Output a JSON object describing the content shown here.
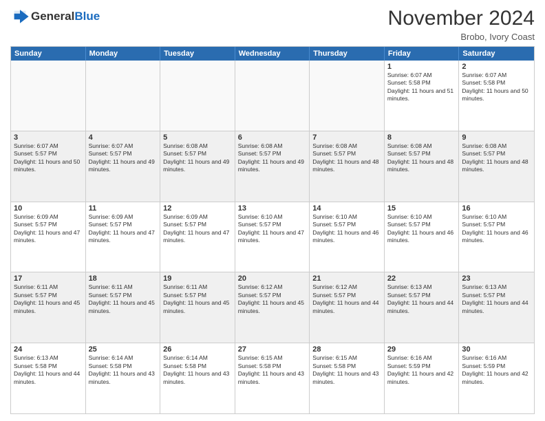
{
  "header": {
    "logo_general": "General",
    "logo_blue": "Blue",
    "month": "November 2024",
    "location": "Brobo, Ivory Coast"
  },
  "calendar": {
    "days_of_week": [
      "Sunday",
      "Monday",
      "Tuesday",
      "Wednesday",
      "Thursday",
      "Friday",
      "Saturday"
    ],
    "weeks": [
      [
        {
          "day": "",
          "empty": true
        },
        {
          "day": "",
          "empty": true
        },
        {
          "day": "",
          "empty": true
        },
        {
          "day": "",
          "empty": true
        },
        {
          "day": "",
          "empty": true
        },
        {
          "day": "1",
          "sunrise": "6:07 AM",
          "sunset": "5:58 PM",
          "daylight": "11 hours and 51 minutes."
        },
        {
          "day": "2",
          "sunrise": "6:07 AM",
          "sunset": "5:58 PM",
          "daylight": "11 hours and 50 minutes."
        }
      ],
      [
        {
          "day": "3",
          "sunrise": "6:07 AM",
          "sunset": "5:57 PM",
          "daylight": "11 hours and 50 minutes."
        },
        {
          "day": "4",
          "sunrise": "6:07 AM",
          "sunset": "5:57 PM",
          "daylight": "11 hours and 49 minutes."
        },
        {
          "day": "5",
          "sunrise": "6:08 AM",
          "sunset": "5:57 PM",
          "daylight": "11 hours and 49 minutes."
        },
        {
          "day": "6",
          "sunrise": "6:08 AM",
          "sunset": "5:57 PM",
          "daylight": "11 hours and 49 minutes."
        },
        {
          "day": "7",
          "sunrise": "6:08 AM",
          "sunset": "5:57 PM",
          "daylight": "11 hours and 48 minutes."
        },
        {
          "day": "8",
          "sunrise": "6:08 AM",
          "sunset": "5:57 PM",
          "daylight": "11 hours and 48 minutes."
        },
        {
          "day": "9",
          "sunrise": "6:08 AM",
          "sunset": "5:57 PM",
          "daylight": "11 hours and 48 minutes."
        }
      ],
      [
        {
          "day": "10",
          "sunrise": "6:09 AM",
          "sunset": "5:57 PM",
          "daylight": "11 hours and 47 minutes."
        },
        {
          "day": "11",
          "sunrise": "6:09 AM",
          "sunset": "5:57 PM",
          "daylight": "11 hours and 47 minutes."
        },
        {
          "day": "12",
          "sunrise": "6:09 AM",
          "sunset": "5:57 PM",
          "daylight": "11 hours and 47 minutes."
        },
        {
          "day": "13",
          "sunrise": "6:10 AM",
          "sunset": "5:57 PM",
          "daylight": "11 hours and 47 minutes."
        },
        {
          "day": "14",
          "sunrise": "6:10 AM",
          "sunset": "5:57 PM",
          "daylight": "11 hours and 46 minutes."
        },
        {
          "day": "15",
          "sunrise": "6:10 AM",
          "sunset": "5:57 PM",
          "daylight": "11 hours and 46 minutes."
        },
        {
          "day": "16",
          "sunrise": "6:10 AM",
          "sunset": "5:57 PM",
          "daylight": "11 hours and 46 minutes."
        }
      ],
      [
        {
          "day": "17",
          "sunrise": "6:11 AM",
          "sunset": "5:57 PM",
          "daylight": "11 hours and 45 minutes."
        },
        {
          "day": "18",
          "sunrise": "6:11 AM",
          "sunset": "5:57 PM",
          "daylight": "11 hours and 45 minutes."
        },
        {
          "day": "19",
          "sunrise": "6:11 AM",
          "sunset": "5:57 PM",
          "daylight": "11 hours and 45 minutes."
        },
        {
          "day": "20",
          "sunrise": "6:12 AM",
          "sunset": "5:57 PM",
          "daylight": "11 hours and 45 minutes."
        },
        {
          "day": "21",
          "sunrise": "6:12 AM",
          "sunset": "5:57 PM",
          "daylight": "11 hours and 44 minutes."
        },
        {
          "day": "22",
          "sunrise": "6:13 AM",
          "sunset": "5:57 PM",
          "daylight": "11 hours and 44 minutes."
        },
        {
          "day": "23",
          "sunrise": "6:13 AM",
          "sunset": "5:57 PM",
          "daylight": "11 hours and 44 minutes."
        }
      ],
      [
        {
          "day": "24",
          "sunrise": "6:13 AM",
          "sunset": "5:58 PM",
          "daylight": "11 hours and 44 minutes."
        },
        {
          "day": "25",
          "sunrise": "6:14 AM",
          "sunset": "5:58 PM",
          "daylight": "11 hours and 43 minutes."
        },
        {
          "day": "26",
          "sunrise": "6:14 AM",
          "sunset": "5:58 PM",
          "daylight": "11 hours and 43 minutes."
        },
        {
          "day": "27",
          "sunrise": "6:15 AM",
          "sunset": "5:58 PM",
          "daylight": "11 hours and 43 minutes."
        },
        {
          "day": "28",
          "sunrise": "6:15 AM",
          "sunset": "5:58 PM",
          "daylight": "11 hours and 43 minutes."
        },
        {
          "day": "29",
          "sunrise": "6:16 AM",
          "sunset": "5:59 PM",
          "daylight": "11 hours and 42 minutes."
        },
        {
          "day": "30",
          "sunrise": "6:16 AM",
          "sunset": "5:59 PM",
          "daylight": "11 hours and 42 minutes."
        }
      ]
    ]
  }
}
